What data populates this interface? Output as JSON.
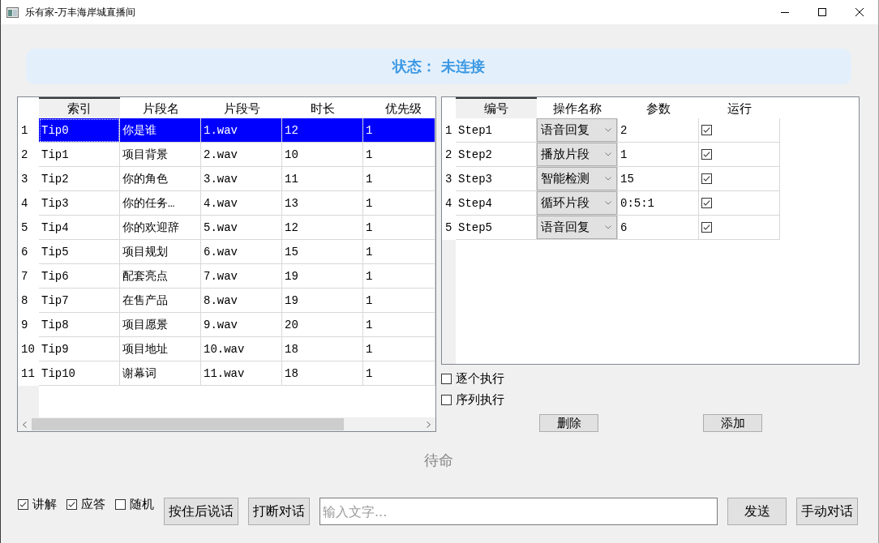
{
  "window": {
    "title": "乐有家-万丰海岸城直播间"
  },
  "status": {
    "label": "状态：",
    "value": "未连接"
  },
  "clips_table": {
    "columns": [
      {
        "label": "索引",
        "selected": true
      },
      {
        "label": "片段名",
        "selected": false
      },
      {
        "label": "片段号",
        "selected": false
      },
      {
        "label": "时长",
        "selected": false
      },
      {
        "label": "优先级",
        "selected": false
      }
    ],
    "rows": [
      {
        "number": "1",
        "cells": [
          "Tip0",
          "你是谁",
          "1.wav",
          "12",
          "1"
        ],
        "selected": true
      },
      {
        "number": "2",
        "cells": [
          "Tip1",
          "项目背景",
          "2.wav",
          "10",
          "1"
        ],
        "selected": false
      },
      {
        "number": "3",
        "cells": [
          "Tip2",
          "你的角色",
          "3.wav",
          "11",
          "1"
        ],
        "selected": false
      },
      {
        "number": "4",
        "cells": [
          "Tip3",
          "你的任务…",
          "4.wav",
          "13",
          "1"
        ],
        "selected": false
      },
      {
        "number": "5",
        "cells": [
          "Tip4",
          "你的欢迎辞",
          "5.wav",
          "12",
          "1"
        ],
        "selected": false
      },
      {
        "number": "6",
        "cells": [
          "Tip5",
          "项目规划",
          "6.wav",
          "15",
          "1"
        ],
        "selected": false
      },
      {
        "number": "7",
        "cells": [
          "Tip6",
          "配套亮点",
          "7.wav",
          "19",
          "1"
        ],
        "selected": false
      },
      {
        "number": "8",
        "cells": [
          "Tip7",
          "在售产品",
          "8.wav",
          "19",
          "1"
        ],
        "selected": false
      },
      {
        "number": "9",
        "cells": [
          "Tip8",
          "项目愿景",
          "9.wav",
          "20",
          "1"
        ],
        "selected": false
      },
      {
        "number": "10",
        "cells": [
          "Tip9",
          "项目地址",
          "10.wav",
          "18",
          "1"
        ],
        "selected": false
      },
      {
        "number": "11",
        "cells": [
          "Tip10",
          "谢幕词",
          "11.wav",
          "18",
          "1"
        ],
        "selected": false
      }
    ]
  },
  "steps_table": {
    "columns": [
      {
        "label": "编号",
        "selected": true
      },
      {
        "label": "操作名称",
        "selected": false
      },
      {
        "label": "参数",
        "selected": false
      },
      {
        "label": "运行",
        "selected": false
      }
    ],
    "rows": [
      {
        "number": "1",
        "id": "Step1",
        "operation": "语音回复",
        "parameter": "2",
        "run": true
      },
      {
        "number": "2",
        "id": "Step2",
        "operation": "播放片段",
        "parameter": "1",
        "run": true
      },
      {
        "number": "3",
        "id": "Step3",
        "operation": "智能检测",
        "parameter": "15",
        "run": true
      },
      {
        "number": "4",
        "id": "Step4",
        "operation": "循环片段",
        "parameter": "0:5:1",
        "run": true
      },
      {
        "number": "5",
        "id": "Step5",
        "operation": "语音回复",
        "parameter": "6",
        "run": true
      }
    ]
  },
  "run_options": [
    {
      "label": "逐个执行",
      "checked": false
    },
    {
      "label": "序列执行",
      "checked": false
    }
  ],
  "step_buttons": [
    "删除",
    "添加"
  ],
  "state": "待命",
  "bottom_bar": {
    "options": [
      {
        "label": "讲解",
        "checked": true
      },
      {
        "label": "应答",
        "checked": true
      },
      {
        "label": "随机",
        "checked": false
      }
    ],
    "action_buttons": [
      "按住后说话",
      "打断对话"
    ],
    "input": {
      "placeholder": "输入文字..."
    },
    "send_buttons": [
      "发送",
      "手动对话"
    ]
  }
}
